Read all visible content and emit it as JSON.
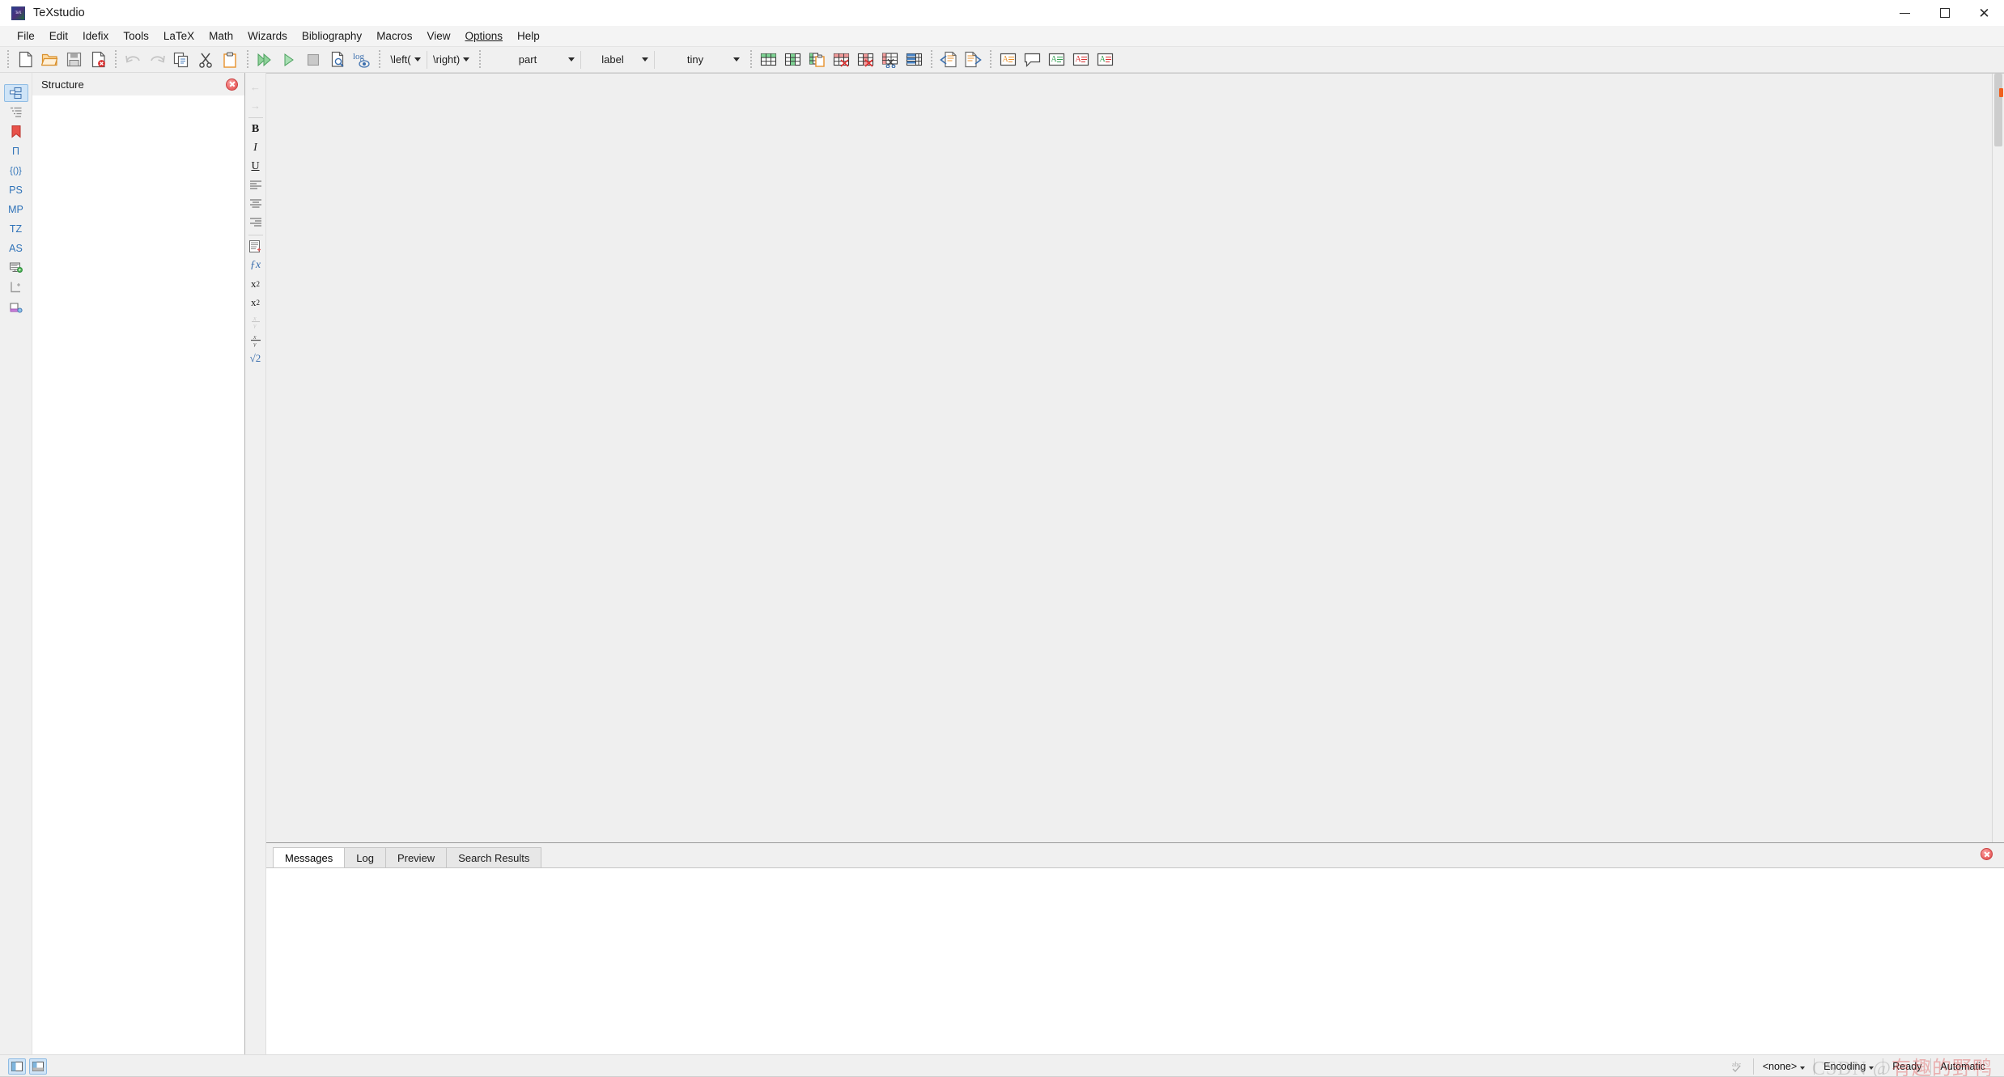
{
  "window": {
    "title": "TeXstudio",
    "app_icon": "texstudio-logo-icon",
    "controls": {
      "minimize": "minimize-icon",
      "maximize": "maximize-icon",
      "close": "close-icon"
    }
  },
  "menubar": {
    "items": [
      {
        "label": "File"
      },
      {
        "label": "Edit"
      },
      {
        "label": "Idefix"
      },
      {
        "label": "Tools"
      },
      {
        "label": "LaTeX"
      },
      {
        "label": "Math"
      },
      {
        "label": "Wizards"
      },
      {
        "label": "Bibliography"
      },
      {
        "label": "Macros"
      },
      {
        "label": "View"
      },
      {
        "label": "Options",
        "underlined": true
      },
      {
        "label": "Help"
      }
    ]
  },
  "toolbar": {
    "file_group": [
      {
        "name": "new-document-icon",
        "tooltip": "New"
      },
      {
        "name": "open-folder-icon",
        "tooltip": "Open"
      },
      {
        "name": "save-icon",
        "tooltip": "Save"
      },
      {
        "name": "close-document-icon",
        "tooltip": "Close"
      }
    ],
    "edit_group": [
      {
        "name": "undo-icon",
        "tooltip": "Undo",
        "disabled": true
      },
      {
        "name": "redo-icon",
        "tooltip": "Redo",
        "disabled": true
      },
      {
        "name": "copy-icon",
        "tooltip": "Copy"
      },
      {
        "name": "cut-scissors-icon",
        "tooltip": "Cut"
      },
      {
        "name": "paste-clipboard-icon",
        "tooltip": "Paste"
      }
    ],
    "build_group": [
      {
        "name": "build-and-view-icon",
        "tooltip": "Build & View"
      },
      {
        "name": "compile-icon",
        "tooltip": "Compile"
      },
      {
        "name": "stop-icon",
        "tooltip": "Stop"
      },
      {
        "name": "view-pdf-icon",
        "tooltip": "View PDF"
      },
      {
        "name": "view-log-icon",
        "tooltip": "View Log",
        "text": "log"
      }
    ],
    "combos": {
      "left_delimiter": "\\left(",
      "right_delimiter": "\\right)",
      "section_level": "part",
      "reference_type": "label",
      "font_size": "tiny"
    },
    "table_group": [
      {
        "name": "add-row-icon",
        "tooltip": "Add Row"
      },
      {
        "name": "add-column-icon",
        "tooltip": "Add Column"
      },
      {
        "name": "paste-table-icon",
        "tooltip": "Paste Table"
      },
      {
        "name": "remove-row-icon",
        "tooltip": "Remove Row"
      },
      {
        "name": "remove-column-icon",
        "tooltip": "Remove Column"
      },
      {
        "name": "cut-row-icon",
        "tooltip": "Cut Row"
      },
      {
        "name": "table-template-icon",
        "tooltip": "Table Template"
      }
    ],
    "nav_group": [
      {
        "name": "previous-document-icon",
        "tooltip": "Previous Document"
      },
      {
        "name": "next-document-icon",
        "tooltip": "Next Document"
      }
    ],
    "annotation_group": [
      {
        "name": "highlight-orange-icon",
        "tooltip": "Highlight"
      },
      {
        "name": "comment-bubble-icon",
        "tooltip": "Comment"
      },
      {
        "name": "highlight-green-icon",
        "tooltip": "Mark Green"
      },
      {
        "name": "highlight-red-icon",
        "tooltip": "Mark Red"
      },
      {
        "name": "highlight-green-alt-icon",
        "tooltip": "Mark Green Alt"
      }
    ]
  },
  "left_rail": {
    "items": [
      {
        "name": "sidebar-structure-icon",
        "label": "",
        "icon": "tree-structure",
        "active": true
      },
      {
        "name": "sidebar-outline-icon",
        "label": "",
        "icon": "list-outline",
        "active": false
      },
      {
        "name": "sidebar-bookmark-icon",
        "label": "",
        "icon": "bookmark",
        "active": false
      },
      {
        "name": "sidebar-symbols-pi-icon",
        "label": "Π",
        "icon": "text",
        "active": false
      },
      {
        "name": "sidebar-braces-icon",
        "label": "{()}",
        "icon": "text",
        "active": false
      },
      {
        "name": "sidebar-ps-icon",
        "label": "PS",
        "icon": "text",
        "active": false
      },
      {
        "name": "sidebar-mp-icon",
        "label": "MP",
        "icon": "text",
        "active": false
      },
      {
        "name": "sidebar-tz-icon",
        "label": "TZ",
        "icon": "text",
        "active": false
      },
      {
        "name": "sidebar-as-icon",
        "label": "AS",
        "icon": "text",
        "active": false
      },
      {
        "name": "sidebar-presentation-icon",
        "label": "",
        "icon": "monitor-run",
        "active": false
      },
      {
        "name": "sidebar-axis-icon",
        "label": "",
        "icon": "axis",
        "active": false
      },
      {
        "name": "sidebar-open-panel-icon",
        "label": "",
        "icon": "panel-gear",
        "active": false
      }
    ]
  },
  "structure_panel": {
    "title": "Structure",
    "close_icon": "close-icon",
    "content": ""
  },
  "format_toolbar": {
    "items": [
      {
        "name": "back-arrow-icon",
        "glyph": "←",
        "disabled": true
      },
      {
        "name": "forward-arrow-icon",
        "glyph": "→",
        "disabled": true
      },
      {
        "name": "bold-icon",
        "glyph": "B",
        "disabled": false
      },
      {
        "name": "italic-icon",
        "glyph": "I",
        "disabled": false
      },
      {
        "name": "underline-icon",
        "glyph": "U",
        "disabled": false
      },
      {
        "name": "align-left-icon",
        "glyph": "",
        "disabled": false
      },
      {
        "name": "align-center-icon",
        "glyph": "",
        "disabled": false
      },
      {
        "name": "align-right-icon",
        "glyph": "",
        "disabled": false
      },
      {
        "name": "insert-block-icon",
        "glyph": "",
        "disabled": false
      },
      {
        "name": "math-function-icon",
        "glyph": "ƒx",
        "disabled": false
      },
      {
        "name": "subscript-icon",
        "glyph": "x₂",
        "disabled": false
      },
      {
        "name": "superscript-icon",
        "glyph": "x²",
        "disabled": false
      },
      {
        "name": "fraction-dfrac-icon",
        "glyph": "",
        "disabled": true
      },
      {
        "name": "fraction-frac-icon",
        "glyph": "",
        "disabled": false
      },
      {
        "name": "square-root-icon",
        "glyph": "√2",
        "disabled": false
      }
    ]
  },
  "output_panel": {
    "tabs": [
      {
        "label": "Messages",
        "active": true
      },
      {
        "label": "Log",
        "active": false
      },
      {
        "label": "Preview",
        "active": false
      },
      {
        "label": "Search Results",
        "active": false
      }
    ],
    "close_icon": "close-icon",
    "content": ""
  },
  "statusbar": {
    "toggle_left": "toggle-structure-panel-icon",
    "toggle_right": "toggle-output-panel-icon",
    "spellcheck_icon": "spellcheck-icon",
    "language": "<none>",
    "encoding": "Encoding",
    "state": "Ready",
    "line_ending": "Automatic"
  },
  "watermark": {
    "prefix": "CSDN @",
    "text": "有趣的野鸭"
  },
  "colors": {
    "accent_blue": "#2e72b8",
    "selection_blue": "#cfe4f7",
    "green": "#3aa655",
    "red": "#d84a4a",
    "orange": "#e8922c",
    "toolbar_bg": "#f0f0f0",
    "editor_bg": "#efefef"
  }
}
